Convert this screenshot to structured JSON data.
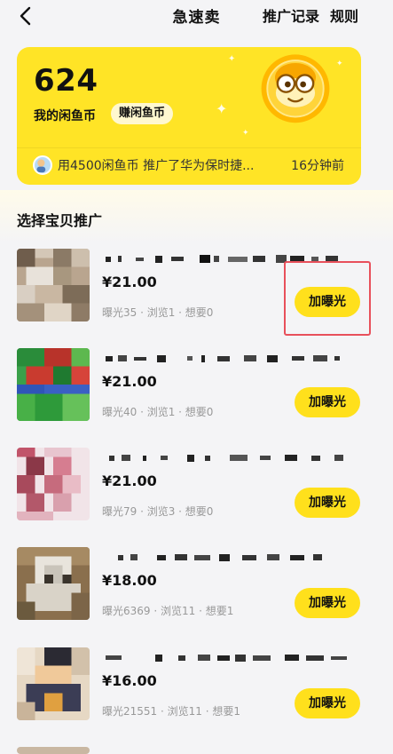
{
  "nav": {
    "title": "急速卖",
    "promo_records": "推广记录",
    "rules": "规则"
  },
  "card": {
    "coin_count": "624",
    "coin_label": "我的闲鱼币",
    "earn_button": "赚闲鱼币",
    "promo_text": "用4500闲鱼币 推广了华为保时捷...",
    "promo_time": "16分钟前"
  },
  "section_title": "选择宝贝推广",
  "items": [
    {
      "price": "¥21.00",
      "stats": "曝光35 · 浏览1 · 想要0",
      "button": "加曝光"
    },
    {
      "price": "¥21.00",
      "stats": "曝光40 · 浏览1 · 想要0",
      "button": "加曝光"
    },
    {
      "price": "¥21.00",
      "stats": "曝光79 · 浏览3 · 想要0",
      "button": "加曝光"
    },
    {
      "price": "¥18.00",
      "stats": "曝光6369 · 浏览11 · 想要1",
      "button": "加曝光"
    },
    {
      "price": "¥16.00",
      "stats": "曝光21551 · 浏览11 · 想要1",
      "button": "加曝光"
    }
  ],
  "colors": {
    "accent": "#ffe01c",
    "card": "#ffe426",
    "highlight": "#e8505b"
  }
}
